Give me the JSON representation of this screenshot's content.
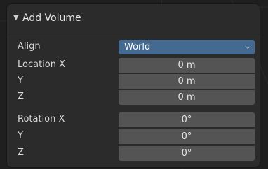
{
  "panel": {
    "title": "Add Volume",
    "collapse_icon": "triangle-down-icon"
  },
  "align": {
    "label": "Align",
    "value": "World",
    "dropdown_icon": "chevron-down-icon"
  },
  "location": {
    "x_label": "Location X",
    "y_label": "Y",
    "z_label": "Z",
    "x": "0 m",
    "y": "0 m",
    "z": "0 m"
  },
  "rotation": {
    "x_label": "Rotation X",
    "y_label": "Y",
    "z_label": "Z",
    "x": "0°",
    "y": "0°",
    "z": "0°"
  },
  "colors": {
    "panel_bg": "#2b2b2b",
    "field_bg": "#545454",
    "select_bg": "#456a91",
    "text": "#e6e6e6"
  }
}
